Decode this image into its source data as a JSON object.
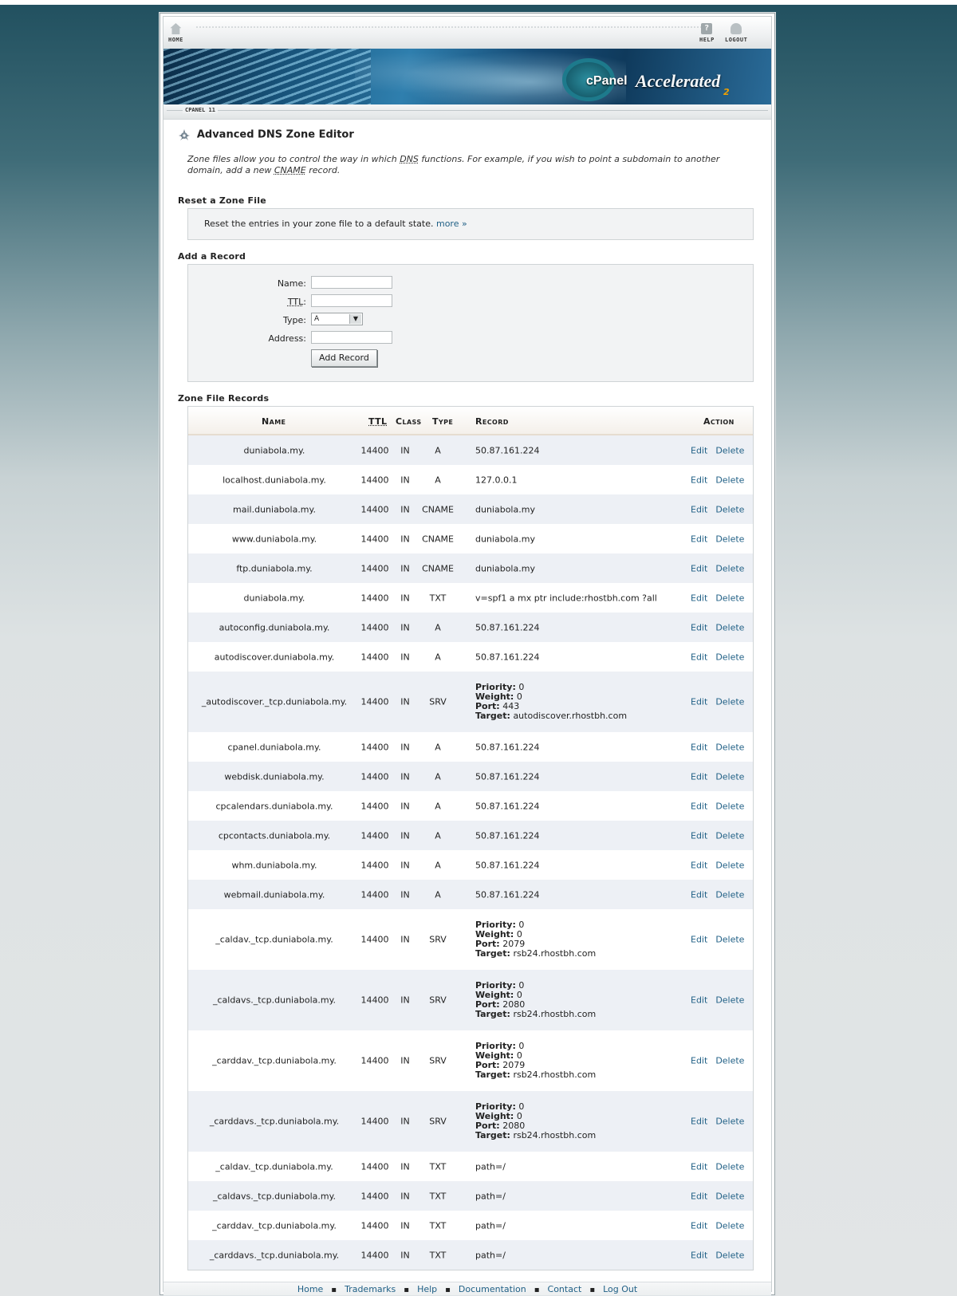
{
  "nav": {
    "home_label": "HOME",
    "help_label": "HELP",
    "logout_label": "LOGOUT",
    "help_glyph": "?"
  },
  "banner": {
    "brand_cpanel": "cPanel",
    "brand_accelerated": "Accelerated",
    "brand_version": "2"
  },
  "breadcrumb": "CPANEL 11",
  "page": {
    "title": "Advanced DNS Zone Editor",
    "intro_part1": "Zone files allow you to control the way in which ",
    "intro_dns": "DNS",
    "intro_part2": " functions. For example, if you wish to point a subdomain to another domain, add a new ",
    "intro_cname": "CNAME",
    "intro_part3": " record."
  },
  "reset": {
    "heading": "Reset a Zone File",
    "text": "Reset the entries in your zone file to a default state.",
    "more_link": "more »"
  },
  "add_record": {
    "heading": "Add a Record",
    "name_label": "Name:",
    "ttl_label": "TTL",
    "ttl_colon": ":",
    "type_label": "Type:",
    "type_value": "A",
    "address_label": "Address:",
    "name_value": "",
    "ttl_value": "",
    "address_value": "",
    "submit_label": "Add Record"
  },
  "zone_records": {
    "heading": "Zone File Records",
    "columns": {
      "name": "Name",
      "ttl": "TTL",
      "class": "Class",
      "type": "Type",
      "record": "Record",
      "action": "Action"
    },
    "edit_label": "Edit",
    "delete_label": "Delete",
    "srv_labels": {
      "priority": "Priority:",
      "weight": "Weight:",
      "port": "Port:",
      "target": "Target:"
    },
    "rows": [
      {
        "name": "duniabola.my.",
        "ttl": "14400",
        "class": "IN",
        "type": "A",
        "record": "50.87.161.224"
      },
      {
        "name": "localhost.duniabola.my.",
        "ttl": "14400",
        "class": "IN",
        "type": "A",
        "record": "127.0.0.1"
      },
      {
        "name": "mail.duniabola.my.",
        "ttl": "14400",
        "class": "IN",
        "type": "CNAME",
        "record": "duniabola.my"
      },
      {
        "name": "www.duniabola.my.",
        "ttl": "14400",
        "class": "IN",
        "type": "CNAME",
        "record": "duniabola.my"
      },
      {
        "name": "ftp.duniabola.my.",
        "ttl": "14400",
        "class": "IN",
        "type": "CNAME",
        "record": "duniabola.my"
      },
      {
        "name": "duniabola.my.",
        "ttl": "14400",
        "class": "IN",
        "type": "TXT",
        "record": "v=spf1 a mx ptr include:rhostbh.com ?all"
      },
      {
        "name": "autoconfig.duniabola.my.",
        "ttl": "14400",
        "class": "IN",
        "type": "A",
        "record": "50.87.161.224"
      },
      {
        "name": "autodiscover.duniabola.my.",
        "ttl": "14400",
        "class": "IN",
        "type": "A",
        "record": "50.87.161.224"
      },
      {
        "name": "_autodiscover._tcp.duniabola.my.",
        "ttl": "14400",
        "class": "IN",
        "type": "SRV",
        "priority": "0",
        "weight": "0",
        "port": "443",
        "target": "autodiscover.rhostbh.com"
      },
      {
        "name": "cpanel.duniabola.my.",
        "ttl": "14400",
        "class": "IN",
        "type": "A",
        "record": "50.87.161.224"
      },
      {
        "name": "webdisk.duniabola.my.",
        "ttl": "14400",
        "class": "IN",
        "type": "A",
        "record": "50.87.161.224"
      },
      {
        "name": "cpcalendars.duniabola.my.",
        "ttl": "14400",
        "class": "IN",
        "type": "A",
        "record": "50.87.161.224"
      },
      {
        "name": "cpcontacts.duniabola.my.",
        "ttl": "14400",
        "class": "IN",
        "type": "A",
        "record": "50.87.161.224"
      },
      {
        "name": "whm.duniabola.my.",
        "ttl": "14400",
        "class": "IN",
        "type": "A",
        "record": "50.87.161.224"
      },
      {
        "name": "webmail.duniabola.my.",
        "ttl": "14400",
        "class": "IN",
        "type": "A",
        "record": "50.87.161.224"
      },
      {
        "name": "_caldav._tcp.duniabola.my.",
        "ttl": "14400",
        "class": "IN",
        "type": "SRV",
        "priority": "0",
        "weight": "0",
        "port": "2079",
        "target": "rsb24.rhostbh.com"
      },
      {
        "name": "_caldavs._tcp.duniabola.my.",
        "ttl": "14400",
        "class": "IN",
        "type": "SRV",
        "priority": "0",
        "weight": "0",
        "port": "2080",
        "target": "rsb24.rhostbh.com"
      },
      {
        "name": "_carddav._tcp.duniabola.my.",
        "ttl": "14400",
        "class": "IN",
        "type": "SRV",
        "priority": "0",
        "weight": "0",
        "port": "2079",
        "target": "rsb24.rhostbh.com"
      },
      {
        "name": "_carddavs._tcp.duniabola.my.",
        "ttl": "14400",
        "class": "IN",
        "type": "SRV",
        "priority": "0",
        "weight": "0",
        "port": "2080",
        "target": "rsb24.rhostbh.com"
      },
      {
        "name": "_caldav._tcp.duniabola.my.",
        "ttl": "14400",
        "class": "IN",
        "type": "TXT",
        "record": "path=/"
      },
      {
        "name": "_caldavs._tcp.duniabola.my.",
        "ttl": "14400",
        "class": "IN",
        "type": "TXT",
        "record": "path=/"
      },
      {
        "name": "_carddav._tcp.duniabola.my.",
        "ttl": "14400",
        "class": "IN",
        "type": "TXT",
        "record": "path=/"
      },
      {
        "name": "_carddavs._tcp.duniabola.my.",
        "ttl": "14400",
        "class": "IN",
        "type": "TXT",
        "record": "path=/"
      }
    ]
  },
  "footer": {
    "links": [
      "Home",
      "Trademarks",
      "Help",
      "Documentation",
      "Contact",
      "Log Out"
    ],
    "separator": "▪"
  },
  "colors": {
    "link": "#1f5f85",
    "row_alt": "#edf0f5",
    "box_bg": "#f2f3f4"
  }
}
